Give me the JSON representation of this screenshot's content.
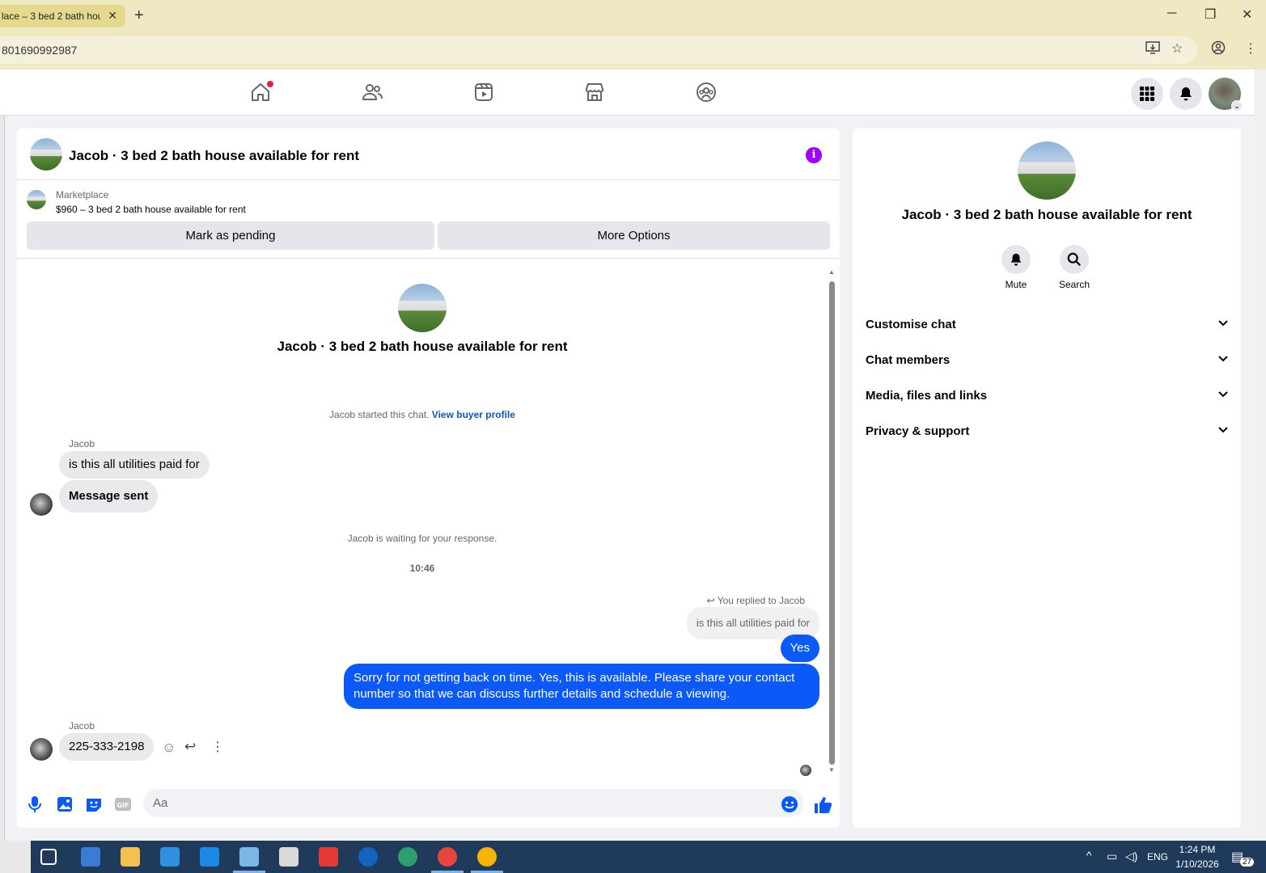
{
  "browser": {
    "tab_title": "lace – 3 bed 2 bath hou",
    "url": "801690992987"
  },
  "chat": {
    "title": "Jacob · 3 bed 2 bath house available for rent",
    "marketplace_label": "Marketplace",
    "listing": "$960 – 3 bed 2 bath house available for rent",
    "mark_pending": "Mark as pending",
    "more_options": "More Options",
    "center_title": "Jacob · 3 bed 2 bath house available for rent",
    "started_text": "Jacob started this chat.",
    "view_buyer": "View buyer profile",
    "sender1": "Jacob",
    "msg1": "is this all utilities paid for",
    "msg2": "Message sent",
    "waiting": "Jacob is waiting for your response.",
    "time": "10:46",
    "replied_to": "You replied to Jacob",
    "quoted": "is this all utilities paid for",
    "out1": "Yes",
    "out2": "Sorry for not getting back on time. Yes, this is available. Please share your contact number so that we can discuss further details and schedule a viewing.",
    "sender2": "Jacob",
    "msg3": "225-333-2198",
    "input_placeholder": "Aa"
  },
  "info_panel": {
    "title": "Jacob · 3 bed 2 bath house available for rent",
    "mute": "Mute",
    "search": "Search",
    "sections": [
      "Customise chat",
      "Chat members",
      "Media, files and links",
      "Privacy & support"
    ]
  },
  "taskbar": {
    "lang": "ENG",
    "time": "1:24 PM",
    "date": "1/10/2026",
    "notif_count": "27"
  },
  "colors": {
    "messenger_blue": "#0a59f8",
    "info_purple": "#a100ff"
  }
}
